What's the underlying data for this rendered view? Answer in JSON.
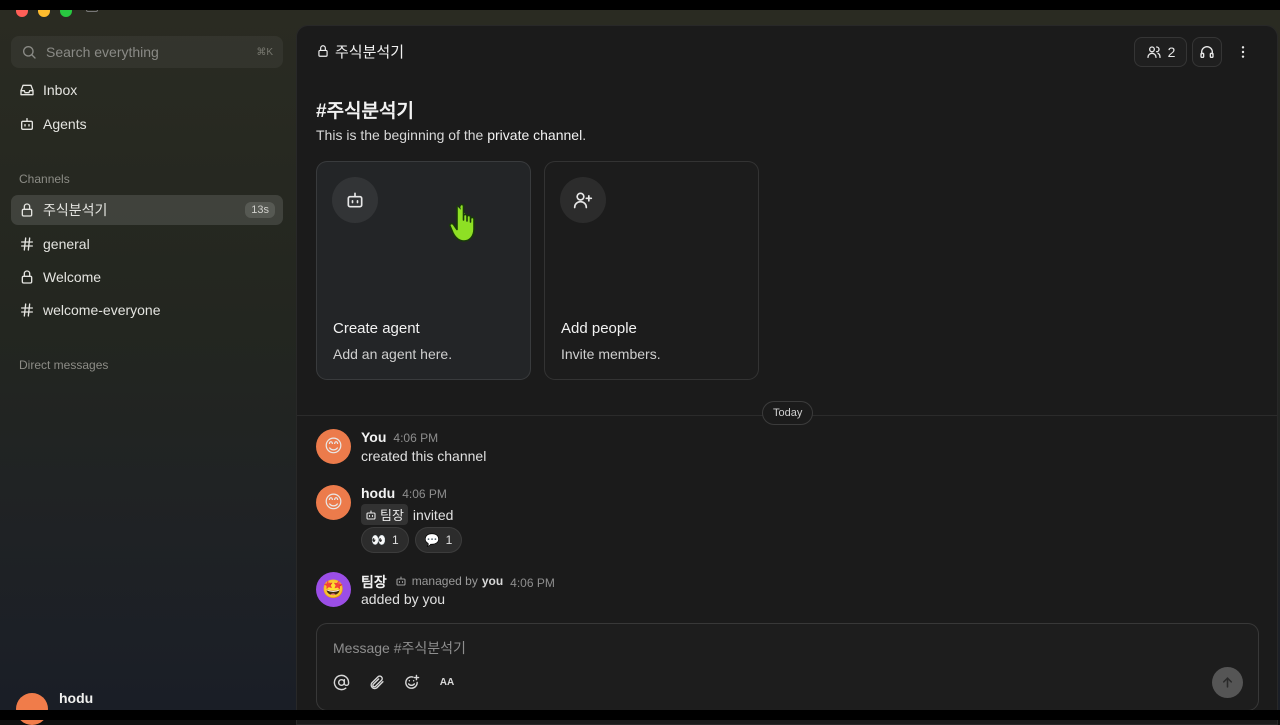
{
  "sidebar": {
    "search_placeholder": "Search everything",
    "search_shortcut": "⌘K",
    "nav": [
      {
        "label": "Inbox",
        "icon": "inbox-icon"
      },
      {
        "label": "Agents",
        "icon": "bot-icon"
      }
    ],
    "channels_title": "Channels",
    "channels": [
      {
        "label": "주식분석기",
        "icon": "lock-icon",
        "badge": "13s",
        "active": true
      },
      {
        "label": "general",
        "icon": "hash-icon"
      },
      {
        "label": "Welcome",
        "icon": "lock-icon"
      },
      {
        "label": "welcome-everyone",
        "icon": "hash-icon"
      }
    ],
    "dm_title": "Direct messages",
    "current_user": "hodu"
  },
  "header": {
    "channel_name": "주식분석기",
    "member_count": "2"
  },
  "intro": {
    "title": "#주식분석기",
    "desc_prefix": "This is the beginning of the ",
    "desc_emph": "private channel",
    "desc_suffix": "."
  },
  "cards": [
    {
      "title": "Create agent",
      "desc": "Add an agent here.",
      "icon": "bot-icon"
    },
    {
      "title": "Add people",
      "desc": "Invite members.",
      "icon": "user-plus-icon"
    }
  ],
  "divider_label": "Today",
  "messages": [
    {
      "author": "You",
      "time": "4:06 PM",
      "text": "created this channel"
    },
    {
      "author": "hodu",
      "time": "4:06 PM",
      "mention": "팀장",
      "text": "invited",
      "reactions": [
        {
          "emoji": "👀",
          "count": "1"
        },
        {
          "emoji": "💬",
          "count": "1"
        }
      ]
    },
    {
      "author": "팀장",
      "managed_label": "managed by",
      "managed_by": "you",
      "time": "4:06 PM",
      "text": "added by you"
    }
  ],
  "composer": {
    "placeholder": "Message #주식분석기",
    "format_label": "AA"
  },
  "colors": {
    "accent_orange": "#ec7b4b",
    "accent_purple": "#9b4ee6",
    "cursor_green": "#8ee024"
  }
}
